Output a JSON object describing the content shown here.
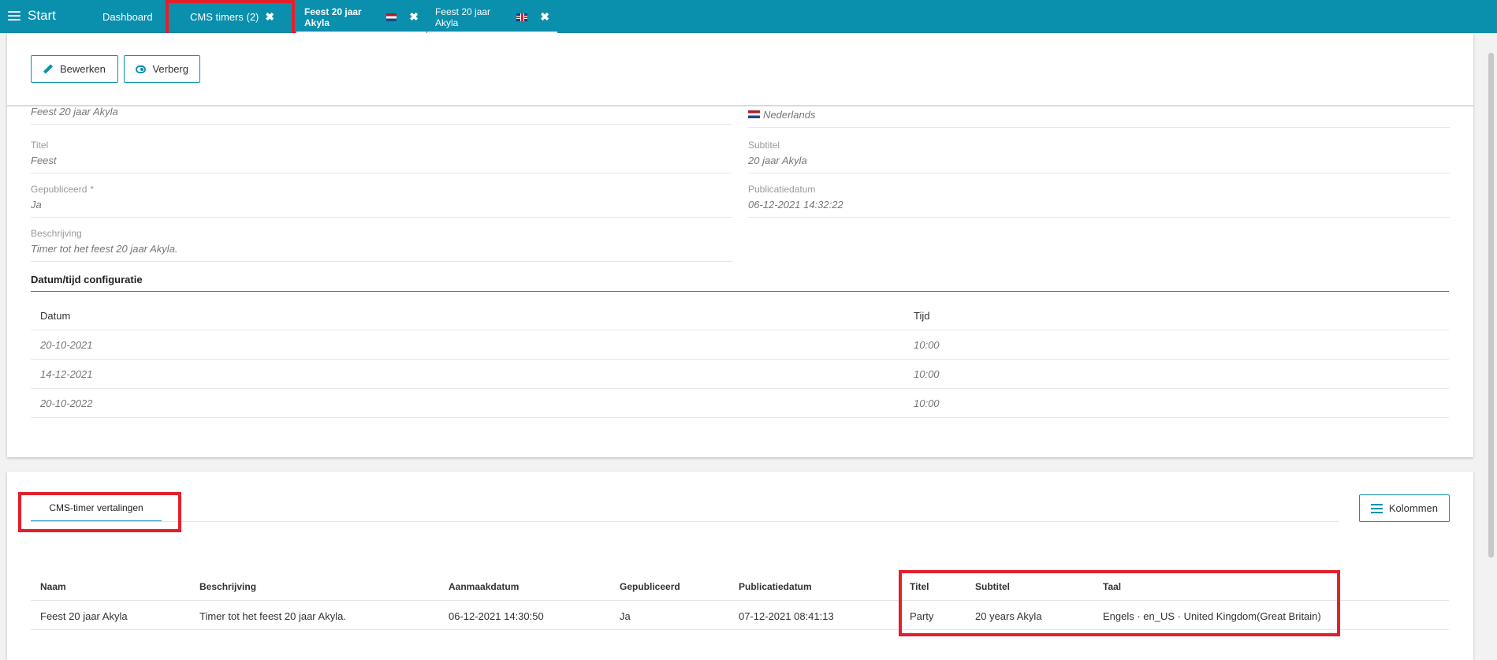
{
  "topbar": {
    "start_label": "Start",
    "tabs": [
      {
        "label": "Dashboard",
        "closable": false
      },
      {
        "label": "CMS timers (2)",
        "closable": true
      },
      {
        "label": "Feest 20 jaar Akyla",
        "flag": "nl",
        "closable": true
      },
      {
        "label": "Feest 20 jaar Akyla",
        "flag": "uk",
        "closable": true
      }
    ],
    "close_glyph": "✖"
  },
  "toolbar": {
    "edit_label": "Bewerken",
    "hide_label": "Verberg"
  },
  "details": {
    "name_value": "Feest 20 jaar Akyla",
    "language_value": "Nederlands",
    "title_label": "Titel",
    "title_value": "Feest",
    "subtitle_label": "Subtitel",
    "subtitle_value": "20 jaar Akyla",
    "published_label": "Gepubliceerd",
    "published_required": "*",
    "published_value": "Ja",
    "pubdate_label": "Publicatiedatum",
    "pubdate_value": "06-12-2021 14:32:22",
    "description_label": "Beschrijving",
    "description_value": "Timer tot het feest 20 jaar Akyla."
  },
  "datetime_config": {
    "title": "Datum/tijd configuratie",
    "columns": [
      "Datum",
      "Tijd"
    ],
    "rows": [
      [
        "20-10-2021",
        "10:00"
      ],
      [
        "14-12-2021",
        "10:00"
      ],
      [
        "20-10-2022",
        "10:00"
      ]
    ]
  },
  "translations": {
    "tab_label": "CMS-timer vertalingen",
    "columns_button": "Kolommen",
    "columns": [
      "Naam",
      "Beschrijving",
      "Aanmaakdatum",
      "Gepubliceerd",
      "Publicatiedatum",
      "Titel",
      "Subtitel",
      "Taal"
    ],
    "rows": [
      [
        "Feest 20 jaar Akyla",
        "Timer tot het feest 20 jaar Akyla.",
        "06-12-2021 14:30:50",
        "Ja",
        "07-12-2021 08:41:13",
        "Party",
        "20 years Akyla",
        "Engels · en_US · United Kingdom(Great Britain)"
      ]
    ]
  },
  "colors": {
    "accent": "#0a8fad",
    "highlight": "#e0212b"
  }
}
